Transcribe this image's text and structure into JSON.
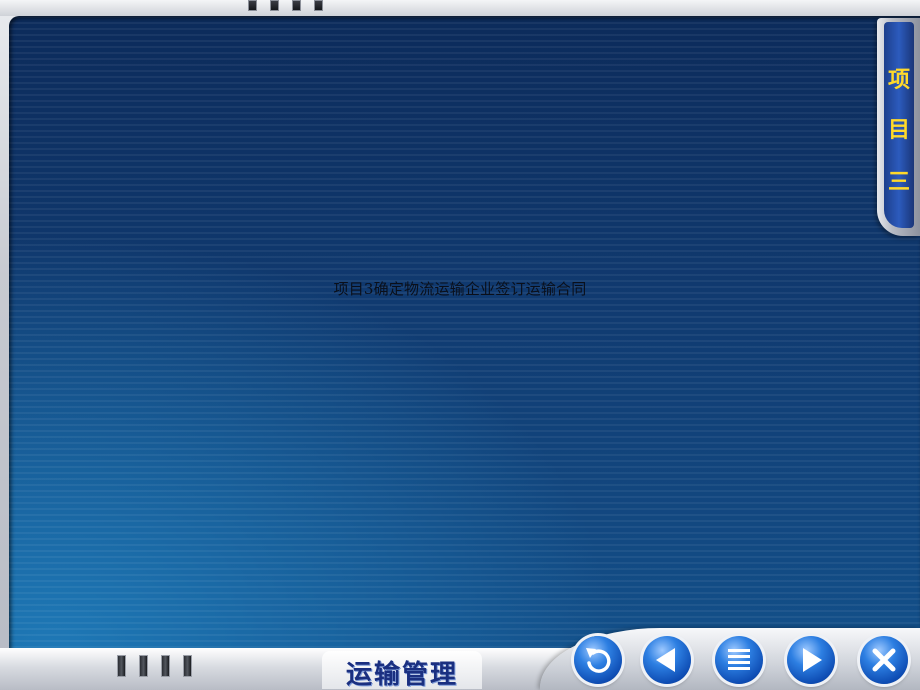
{
  "slide": {
    "main_text": "项目3确定物流运输企业签订运输合同"
  },
  "side_tab": {
    "chars": [
      "项",
      "目",
      "三"
    ]
  },
  "bottom_bar": {
    "course_title": "运输管理"
  },
  "nav_buttons": [
    {
      "icon": "return-icon"
    },
    {
      "icon": "previous-arrow-icon"
    },
    {
      "icon": "menu-list-icon"
    },
    {
      "icon": "next-arrow-icon"
    },
    {
      "icon": "close-icon"
    }
  ],
  "colors": {
    "screen_blue": "#103a70",
    "side_tab_text": "#ffd92a",
    "title_blue": "#1a2f80",
    "button_blue": "#2d7fe2"
  }
}
